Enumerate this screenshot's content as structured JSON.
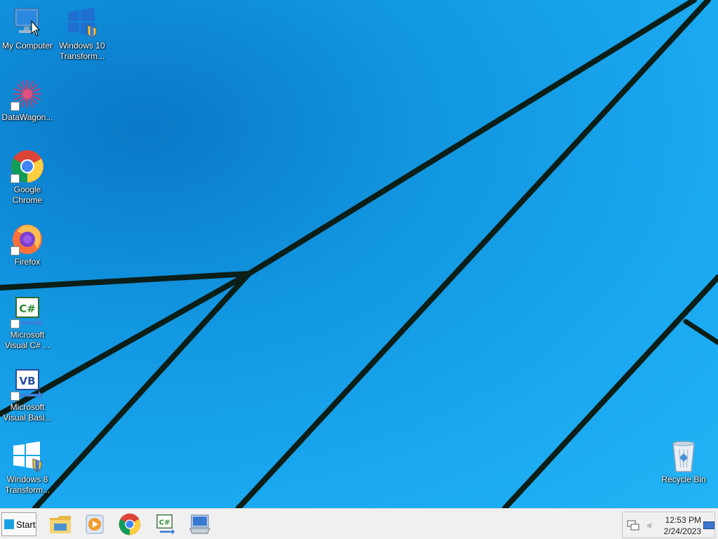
{
  "desktop": {
    "icons": [
      {
        "label": "My Computer",
        "icon": "my-computer-icon"
      },
      {
        "label": "Windows 10 Transform...",
        "icon": "windows-setup-icon"
      },
      {
        "label": "DataWagon...",
        "icon": "datawagon-icon"
      },
      {
        "label": "Google Chrome",
        "icon": "chrome-icon"
      },
      {
        "label": "Firefox",
        "icon": "firefox-icon"
      },
      {
        "label": "Microsoft Visual C# ...",
        "icon": "visual-csharp-icon"
      },
      {
        "label": "Microsoft Visual Basi...",
        "icon": "visual-basic-icon"
      },
      {
        "label": "Windows 8 Transform...",
        "icon": "windows-setup-icon"
      },
      {
        "label": "Recycle Bin",
        "icon": "recycle-bin-icon"
      }
    ]
  },
  "taskbar": {
    "start_label": "Start",
    "pinned": [
      {
        "name": "file-explorer",
        "icon": "folder-icon"
      },
      {
        "name": "media-player",
        "icon": "media-player-icon"
      },
      {
        "name": "chrome",
        "icon": "chrome-icon"
      },
      {
        "name": "visual-csharp",
        "icon": "visual-csharp-icon"
      },
      {
        "name": "remote-desktop",
        "icon": "remote-desktop-icon"
      }
    ],
    "tray": {
      "time": "12:53 PM",
      "date": "2/24/2023"
    }
  },
  "colors": {
    "wallpaper": "#1aa8f0",
    "taskbar": "#f0f0f0",
    "wallpaper_lines": "#0a1a14"
  }
}
